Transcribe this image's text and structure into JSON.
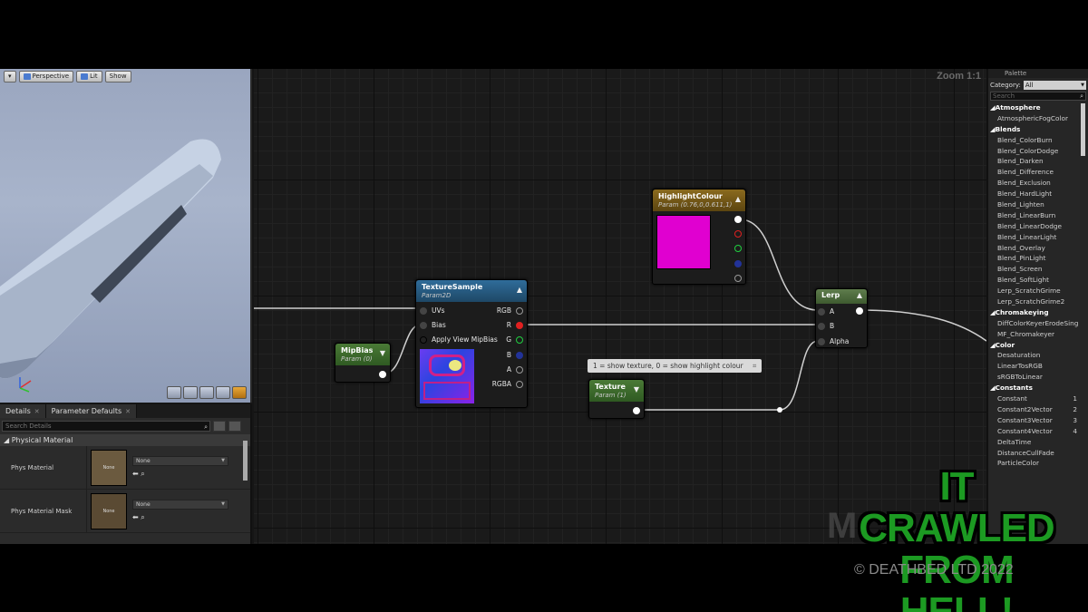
{
  "viewport": {
    "toolbar": {
      "menu": "▾",
      "perspective": "Perspective",
      "lit": "Lit",
      "show": "Show"
    }
  },
  "details": {
    "tabs": [
      "Details",
      "Parameter Defaults"
    ],
    "search_placeholder": "Search Details",
    "section": "Physical Material",
    "properties": [
      {
        "label": "Phys Material",
        "thumb": "None",
        "value": "None"
      },
      {
        "label": "Phys Material Mask",
        "thumb": "None",
        "value": "None"
      }
    ]
  },
  "graph": {
    "zoom": "Zoom 1:1",
    "nodes": {
      "texture_sample": {
        "title": "TextureSample",
        "sub": "Param2D",
        "inputs": [
          "UVs",
          "Bias",
          "Apply View MipBias"
        ],
        "outputs": [
          "RGB",
          "R",
          "G",
          "B",
          "A",
          "RGBA"
        ]
      },
      "mip_bias": {
        "title": "MipBias",
        "sub": "Param (0)"
      },
      "highlight": {
        "title": "HighlightColour",
        "sub": "Param (0.76,0,0.611,1)",
        "swatch": "#e000d0"
      },
      "lerp": {
        "title": "Lerp",
        "inputs": [
          "A",
          "B",
          "Alpha"
        ]
      },
      "texture": {
        "title": "Texture",
        "sub": "Param (1)"
      }
    },
    "comment": "1 = show texture, 0 = show highlight colour"
  },
  "palette": {
    "tab": "Palette",
    "category_label": "Category:",
    "category_value": "All",
    "search_placeholder": "Search",
    "groups": [
      {
        "name": "Atmosphere",
        "items": [
          {
            "label": "AtmosphericFogColor"
          }
        ]
      },
      {
        "name": "Blends",
        "items": [
          {
            "label": "Blend_ColorBurn"
          },
          {
            "label": "Blend_ColorDodge"
          },
          {
            "label": "Blend_Darken"
          },
          {
            "label": "Blend_Difference"
          },
          {
            "label": "Blend_Exclusion"
          },
          {
            "label": "Blend_HardLight"
          },
          {
            "label": "Blend_Lighten"
          },
          {
            "label": "Blend_LinearBurn"
          },
          {
            "label": "Blend_LinearDodge"
          },
          {
            "label": "Blend_LinearLight"
          },
          {
            "label": "Blend_Overlay"
          },
          {
            "label": "Blend_PinLight"
          },
          {
            "label": "Blend_Screen"
          },
          {
            "label": "Blend_SoftLight"
          },
          {
            "label": "Lerp_ScratchGrime"
          },
          {
            "label": "Lerp_ScratchGrime2"
          }
        ]
      },
      {
        "name": "Chromakeying",
        "items": [
          {
            "label": "DiffColorKeyerErodeSing"
          },
          {
            "label": "MF_Chromakeyer"
          }
        ]
      },
      {
        "name": "Color",
        "items": [
          {
            "label": "Desaturation"
          },
          {
            "label": "LinearTosRGB"
          },
          {
            "label": "sRGBToLinear"
          }
        ]
      },
      {
        "name": "Constants",
        "items": [
          {
            "label": "Constant",
            "num": "1"
          },
          {
            "label": "Constant2Vector",
            "num": "2"
          },
          {
            "label": "Constant3Vector",
            "num": "3"
          },
          {
            "label": "Constant4Vector",
            "num": "4"
          },
          {
            "label": "DeltaTime"
          },
          {
            "label": "DistanceCullFade"
          },
          {
            "label": "ParticleColor"
          }
        ]
      }
    ]
  },
  "overlay": {
    "ghost": "M",
    "brand_line1": "IT CRAWLED",
    "brand_line2": "FROM HELL!",
    "copyright": "© DEATHBED LTD 2022"
  },
  "colors": {
    "brand_green": "#1c9a22",
    "highlight_swatch": "#e000d0",
    "lerp_head": "#556f45"
  }
}
